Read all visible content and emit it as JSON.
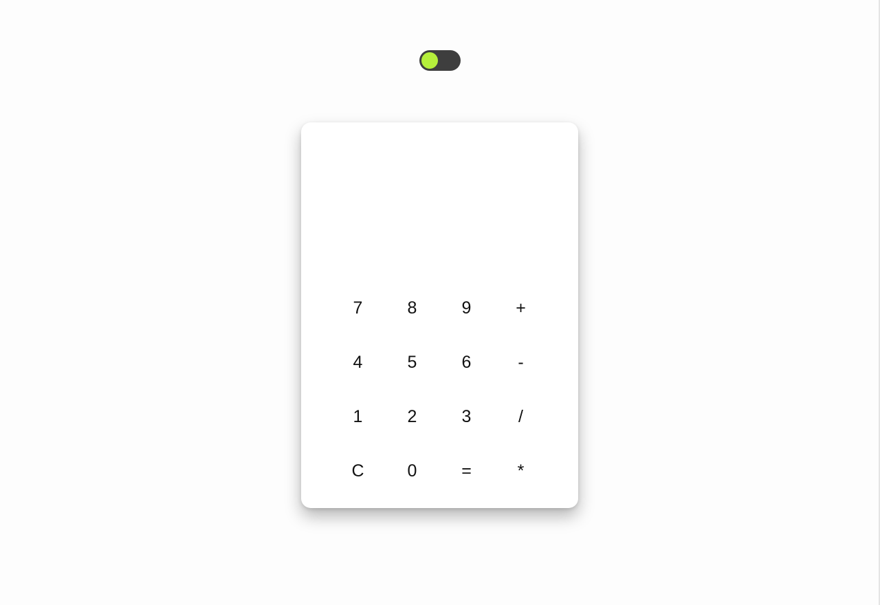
{
  "theme_toggle": {
    "state": "on",
    "knob_color": "#b5ef3b",
    "track_color": "#3e3e3e"
  },
  "calculator": {
    "display_value": "",
    "keys": [
      "7",
      "8",
      "9",
      "+",
      "4",
      "5",
      "6",
      "-",
      "1",
      "2",
      "3",
      "/",
      "C",
      "0",
      "=",
      "*"
    ]
  }
}
